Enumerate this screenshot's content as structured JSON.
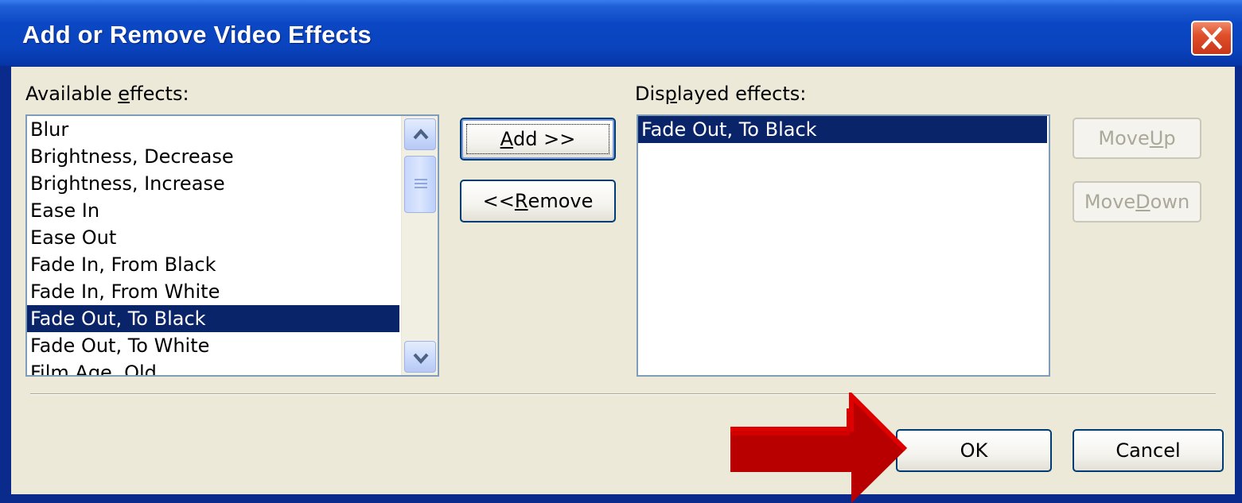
{
  "window": {
    "title": "Add or Remove Video Effects"
  },
  "available": {
    "label_pre": "Available ",
    "label_accel": "e",
    "label_post": "ffects:",
    "items": [
      "Blur",
      "Brightness, Decrease",
      "Brightness, Increase",
      "Ease In",
      "Ease Out",
      "Fade In, From Black",
      "Fade In, From White",
      "Fade Out, To Black",
      "Fade Out, To White",
      "Film Age, Old"
    ],
    "selected_index": 7
  },
  "displayed": {
    "label_pre": "Dis",
    "label_accel": "p",
    "label_post": "layed effects:",
    "items": [
      "Fade Out, To Black"
    ],
    "selected_index": 0
  },
  "buttons": {
    "add": {
      "accel": "A",
      "rest": "dd >>"
    },
    "remove": {
      "pre": "<< ",
      "accel": "R",
      "rest": "emove"
    },
    "move_up": {
      "pre": "Move ",
      "accel": "U",
      "rest": "p"
    },
    "move_down": {
      "pre": "Move ",
      "accel": "D",
      "rest": "own"
    },
    "ok": "OK",
    "cancel": "Cancel"
  },
  "colors": {
    "titlebar": "#0b47c4",
    "selection": "#0a246a",
    "dialog_face": "#ece9d8",
    "annotation_arrow": "#cc0000"
  },
  "icons": {
    "close": "close-icon",
    "scroll_up": "chevron-up-icon",
    "scroll_down": "chevron-down-icon",
    "annotation": "right-arrow-icon"
  }
}
